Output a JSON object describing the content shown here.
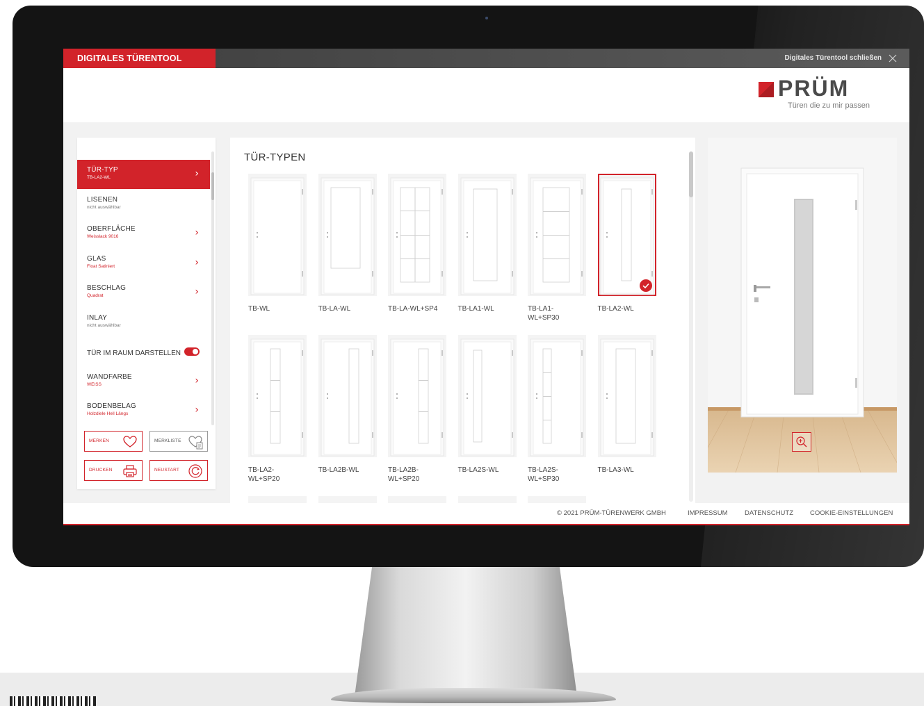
{
  "app": {
    "title": "DIGITALES TÜRENTOOL",
    "close_label": "Digitales Türentool schließen",
    "accent_color": "#d2232a"
  },
  "brand": {
    "name": "PRÜM",
    "tagline": "Türen die zu mir passen"
  },
  "sidebar": {
    "items": [
      {
        "label": "TÜR-TYP",
        "sub": "TB-LA2-WL",
        "active": true,
        "chevron": true
      },
      {
        "label": "LISENEN",
        "sub": "nicht auswählbar",
        "active": false,
        "chevron": false
      },
      {
        "label": "OBERFLÄCHE",
        "sub": "Weisslack 9016",
        "active": false,
        "chevron": true
      },
      {
        "label": "GLAS",
        "sub": "Float Satiniert",
        "active": false,
        "chevron": true
      },
      {
        "label": "BESCHLAG",
        "sub": "Quadrat",
        "active": false,
        "chevron": true
      },
      {
        "label": "INLAY",
        "sub": "nicht auswählbar",
        "active": false,
        "chevron": false
      },
      {
        "label": "WANDFARBE",
        "sub": "WEISS",
        "active": false,
        "chevron": true
      },
      {
        "label": "BODENBELAG",
        "sub": "Holzdiele Hell Längs",
        "active": false,
        "chevron": true
      }
    ],
    "toggle": {
      "label": "TÜR IM RAUM DARSTELLEN",
      "on": true
    },
    "chevron_glyph": "›",
    "actions": {
      "merken": "MERKEN",
      "merkliste": "MERKLISTE",
      "drucken": "DRUCKEN",
      "neustart": "NEUSTART"
    }
  },
  "grid": {
    "title": "TÜR-TYPEN",
    "doors": [
      {
        "name": "TB-WL",
        "style": "plain",
        "selected": false
      },
      {
        "name": "TB-LA-WL",
        "style": "large",
        "selected": false
      },
      {
        "name": "TB-LA-WL+SP4",
        "style": "sp4",
        "selected": false
      },
      {
        "name": "TB-LA1-WL",
        "style": "la1",
        "selected": false
      },
      {
        "name": "TB-LA1-WL+SP30",
        "style": "la1sp30",
        "selected": false
      },
      {
        "name": "TB-LA2-WL",
        "style": "la2",
        "selected": true
      },
      {
        "name": "TB-LA2-WL+SP20",
        "style": "la2sp20",
        "selected": false
      },
      {
        "name": "TB-LA2B-WL",
        "style": "la2b",
        "selected": false
      },
      {
        "name": "TB-LA2B-WL+SP20",
        "style": "la2bsp20",
        "selected": false
      },
      {
        "name": "TB-LA2S-WL",
        "style": "la2s",
        "selected": false
      },
      {
        "name": "TB-LA2S-WL+SP30",
        "style": "la2ssp30",
        "selected": false
      },
      {
        "name": "TB-LA3-WL",
        "style": "la3",
        "selected": false
      }
    ]
  },
  "preview": {
    "zoom_icon": "zoom-in-icon"
  },
  "footer": {
    "copyright": "© 2021 PRÜM-TÜRENWERK GMBH",
    "impressum": "IMPRESSUM",
    "datenschutz": "DATENSCHUTZ",
    "cookies": "COOKIE-EINSTELLUNGEN"
  }
}
